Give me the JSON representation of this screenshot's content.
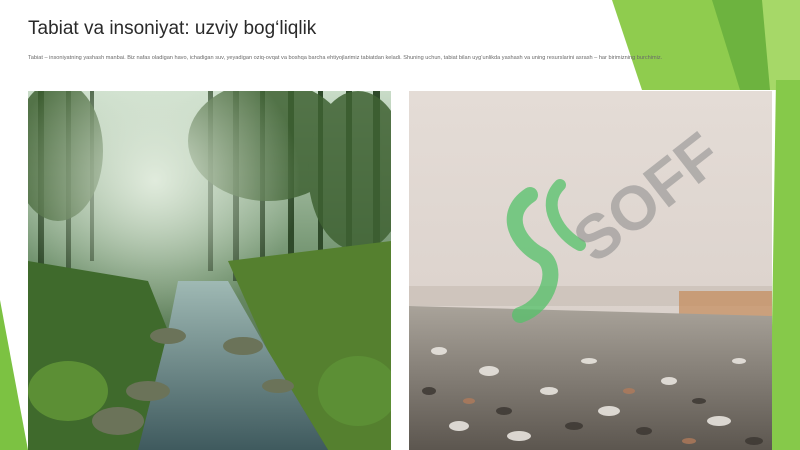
{
  "slide": {
    "title": "Tabiat va insoniyat: uzviy bog‘liqlik",
    "paragraph": "Tabiat – insoniyatning yashash manbai. Biz nafas oladigan havo, ichadigan suv, yeyadigan oziq-ovqat va boshqa barcha ehtiyojlarimiz tabiatdan keladi. Shuning uchun, tabiat bilan uyg‘unlikda yashash va uning resurslarini asrash – har birimizning burchimiz."
  },
  "images": {
    "left": "forest-stream-photo",
    "right": "polluted-littered-shore-photo"
  },
  "watermark": {
    "text": "SOFF"
  },
  "colors": {
    "accent_green": "#7cc242",
    "accent_light_green": "#a8d86a",
    "title": "#2a2a2a",
    "body_text": "#6a6a6a"
  }
}
